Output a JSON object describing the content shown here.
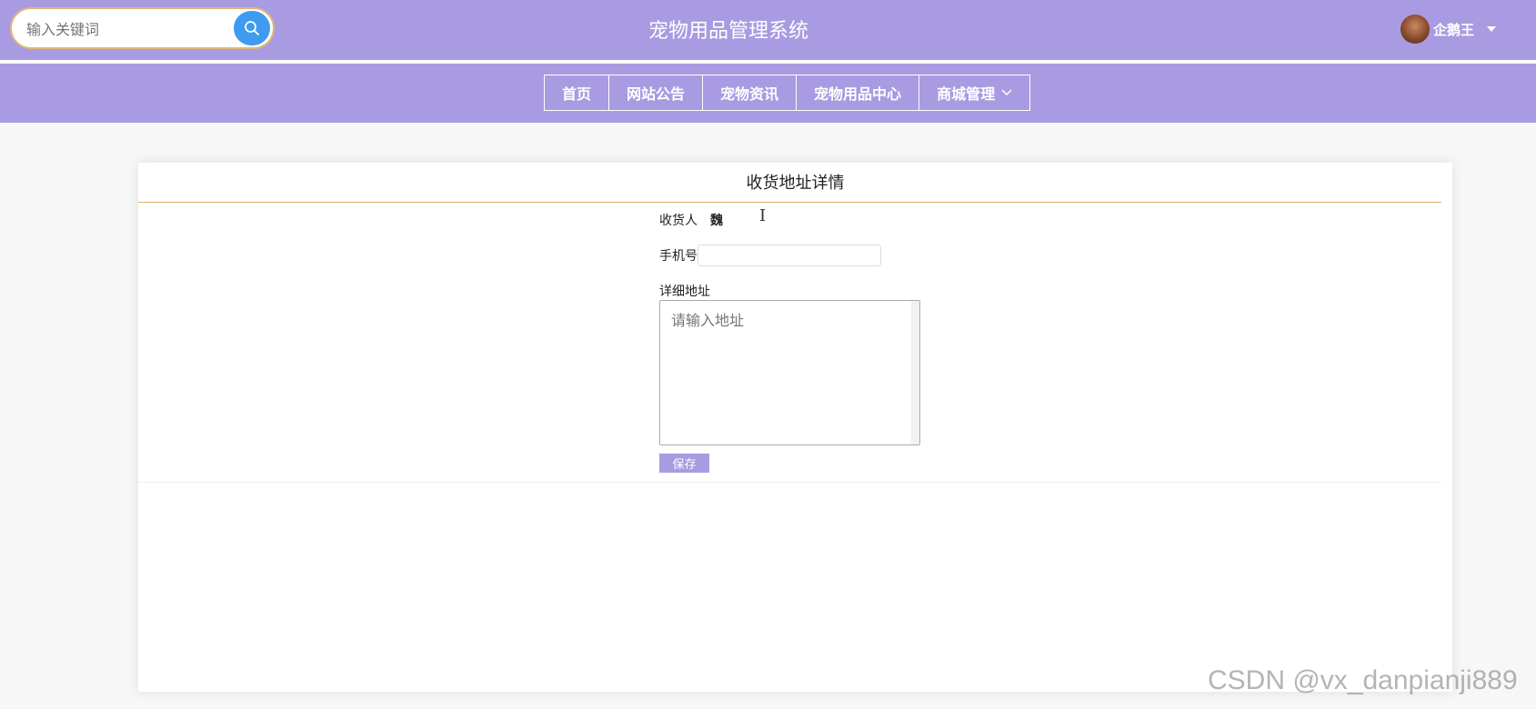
{
  "header": {
    "search_placeholder": "输入关键词",
    "site_title": "宠物用品管理系统",
    "user_name": "企鹅王"
  },
  "nav": {
    "items": [
      {
        "label": "首页"
      },
      {
        "label": "网站公告"
      },
      {
        "label": "宠物资讯"
      },
      {
        "label": "宠物用品中心"
      },
      {
        "label": "商城管理",
        "has_dropdown": true
      }
    ]
  },
  "card": {
    "title": "收货地址详情",
    "form": {
      "name_label": "收货人",
      "name_value": "魏",
      "phone_label": "手机号",
      "phone_value": "",
      "address_label": "详细地址",
      "address_placeholder": "请输入地址",
      "save_label": "保存"
    }
  },
  "watermark": "CSDN @vx_danpianji889",
  "colors": {
    "header_bg": "#a99be1",
    "search_button": "#3e9bf0",
    "search_border": "#e0b777",
    "title_divider": "#d9b262",
    "save_button": "#a99be1"
  },
  "icons": {
    "search": "search-icon",
    "user_menu": "caret-down-icon",
    "nav_dropdown": "chevron-down-icon"
  }
}
